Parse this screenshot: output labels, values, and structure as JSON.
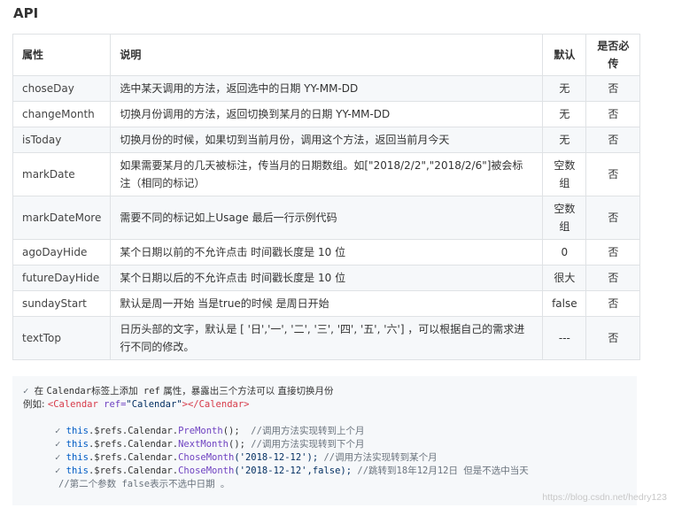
{
  "heading": "API",
  "table": {
    "headers": [
      "属性",
      "说明",
      "默认",
      "是否必传"
    ],
    "rows": [
      {
        "name": "choseDay",
        "desc": "选中某天调用的方法，返回选中的日期 YY-MM-DD",
        "default": "无",
        "required": "否"
      },
      {
        "name": "changeMonth",
        "desc": "切换月份调用的方法，返回切换到某月的日期 YY-MM-DD",
        "default": "无",
        "required": "否"
      },
      {
        "name": "isToday",
        "desc": "切换月份的时候，如果切到当前月份，调用这个方法，返回当前月今天",
        "default": "无",
        "required": "否"
      },
      {
        "name": "markDate",
        "desc": "如果需要某月的几天被标注，传当月的日期数组。如[\"2018/2/2\",\"2018/2/6\"]被会标注（相同的标记）",
        "default": "空数组",
        "required": "否"
      },
      {
        "name": "markDateMore",
        "desc": "需要不同的标记如上Usage 最后一行示例代码",
        "default": "空数组",
        "required": "否"
      },
      {
        "name": "agoDayHide",
        "desc": "某个日期以前的不允许点击 时间戳长度是 10 位",
        "default": "0",
        "required": "否"
      },
      {
        "name": "futureDayHide",
        "desc": "某个日期以后的不允许点击 时间戳长度是 10 位",
        "default": "很大",
        "required": "否"
      },
      {
        "name": "sundayStart",
        "desc": "默认是周一开始 当是true的时候 是周日开始",
        "default": "false",
        "required": "否"
      },
      {
        "name": "textTop",
        "desc": "日历头部的文字，默认是 [ '日','一', '二', '三', '四', '五', '六'] ，可以根据自己的需求进行不同的修改。",
        "default": "---",
        "required": "否"
      }
    ]
  },
  "code": {
    "check_icon": "checkmark-icon",
    "line1": {
      "a": "在 ",
      "b": "Calendar标签上添加 ",
      "c": "ref",
      "d": " 属性，暴露出三个方法可以 直接切换月份"
    },
    "line2": {
      "label": "例如: ",
      "tag_open": "<Calendar",
      "attr": " ref=",
      "val": "\"Calendar\"",
      "tag_close": "></Calendar>"
    },
    "calls": [
      {
        "obj": "this",
        "chain": ".$refs.Calendar.",
        "method": "PreMonth",
        "args": "();",
        "comment": "  //调用方法实现转到上个月"
      },
      {
        "obj": "this",
        "chain": ".$refs.Calendar.",
        "method": "NextMonth",
        "args": "();",
        "comment": " //调用方法实现转到下个月"
      },
      {
        "obj": "this",
        "chain": ".$refs.Calendar.",
        "method": "ChoseMonth",
        "args": "('2018-12-12');",
        "comment": " //调用方法实现转到某个月"
      },
      {
        "obj": "this",
        "chain": ".$refs.Calendar.",
        "method": "ChoseMonth",
        "args": "('2018-12-12',false);",
        "comment": " //跳转到18年12月12日 但是不选中当天"
      }
    ],
    "last_comment": "//第二个参数 false表示不选中日期 。"
  },
  "watermark": "https://blog.csdn.net/hedry123"
}
